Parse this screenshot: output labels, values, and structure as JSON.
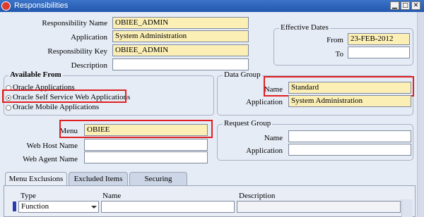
{
  "window": {
    "title": "Responsibilities",
    "buttons": {
      "minimize": "▁",
      "maximize": "□",
      "close": "✕"
    }
  },
  "responsibility": {
    "name_label": "Responsibility Name",
    "name_value": "OBIEE_ADMIN",
    "application_label": "Application",
    "application_value": "System Administration",
    "key_label": "Responsibility Key",
    "key_value": "OBIEE_ADMIN",
    "description_label": "Description",
    "description_value": ""
  },
  "effective_dates": {
    "title": "Effective Dates",
    "from_label": "From",
    "from_value": "23-FEB-2012",
    "to_label": "To",
    "to_value": ""
  },
  "available_from": {
    "title": "Available From",
    "options": [
      {
        "label": "Oracle Applications",
        "selected": false
      },
      {
        "label": "Oracle Self Service Web Applications",
        "selected": true
      },
      {
        "label": "Oracle Mobile Applications",
        "selected": false
      }
    ]
  },
  "data_group": {
    "title": "Data Group",
    "name_label": "Name",
    "name_value": "Standard",
    "application_label": "Application",
    "application_value": "System Administration"
  },
  "menu": {
    "menu_label": "Menu",
    "menu_value": "OBIEE",
    "web_host_label": "Web Host Name",
    "web_host_value": "",
    "web_agent_label": "Web Agent Name",
    "web_agent_value": ""
  },
  "request_group": {
    "title": "Request Group",
    "name_label": "Name",
    "name_value": "",
    "application_label": "Application",
    "application_value": ""
  },
  "tabs": [
    {
      "label": "Menu Exclusions",
      "active": true
    },
    {
      "label": "Excluded Items",
      "active": false
    },
    {
      "label": "Securing Attributes",
      "active": false
    }
  ],
  "exclusions_table": {
    "columns": [
      "Type",
      "Name",
      "Description"
    ],
    "rows": [
      {
        "type": "Function",
        "name": "",
        "description": ""
      }
    ]
  },
  "colors": {
    "highlight": "#e02020",
    "required_field": "#fbefb6",
    "title_bar": "#2257ad"
  }
}
